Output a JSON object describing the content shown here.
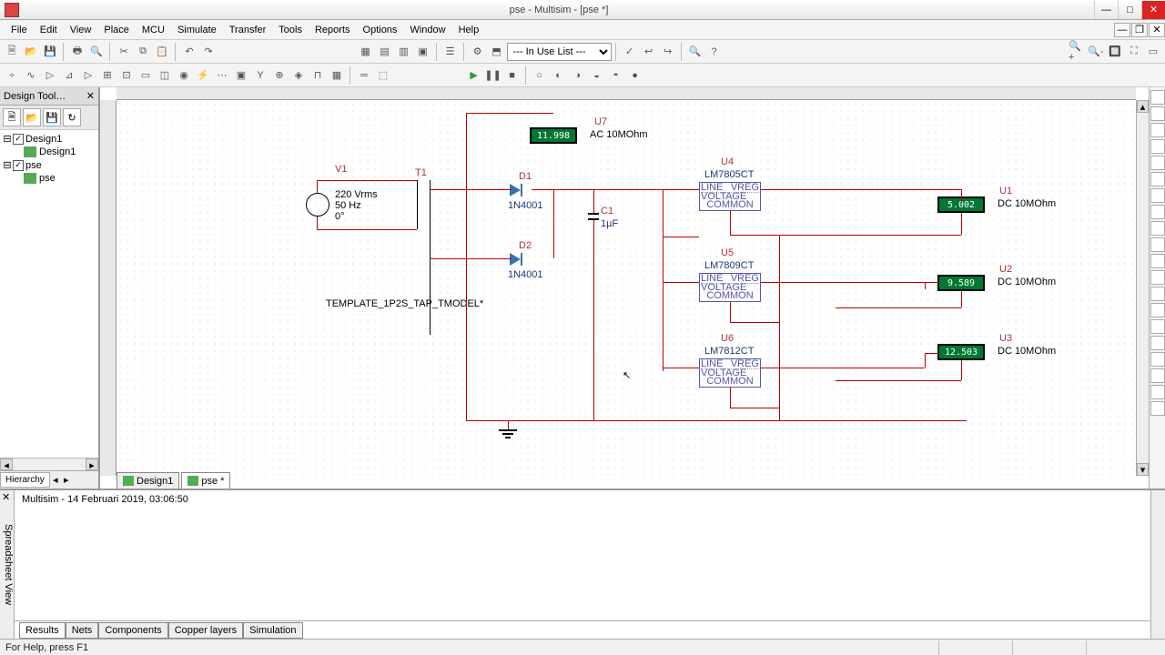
{
  "window": {
    "title": "pse - Multisim - [pse *]"
  },
  "menu": {
    "items": [
      "File",
      "Edit",
      "View",
      "Place",
      "MCU",
      "Simulate",
      "Transfer",
      "Tools",
      "Reports",
      "Options",
      "Window",
      "Help"
    ]
  },
  "toolbar1": {
    "component_filter": "--- In Use List ---"
  },
  "design_toolbox": {
    "title": "Design Tool…",
    "root1": "Design1",
    "child1": "Design1",
    "root2": "pse",
    "child2": "pse",
    "tab": "Hierarchy"
  },
  "schematic": {
    "V1": {
      "ref": "V1",
      "l1": "220 Vrms",
      "l2": "50 Hz",
      "l3": "0°"
    },
    "T1": {
      "ref": "T1",
      "model": "TEMPLATE_1P2S_TAP_TMODEL*"
    },
    "D1": {
      "ref": "D1",
      "val": "1N4001"
    },
    "D2": {
      "ref": "D2",
      "val": "1N4001"
    },
    "C1": {
      "ref": "C1",
      "val": "1µF"
    },
    "U4": {
      "ref": "U4",
      "val": "LM7805CT"
    },
    "U5": {
      "ref": "U5",
      "val": "LM7809CT"
    },
    "U6": {
      "ref": "U6",
      "val": "LM7812CT"
    },
    "reg_line": "LINE",
    "reg_vreg": "VREG",
    "reg_volt": "VOLTAGE",
    "reg_com": "COMMON",
    "U7": {
      "ref": "U7",
      "val": "AC  10MOhm",
      "reading": "11.998"
    },
    "U1": {
      "ref": "U1",
      "val": "DC  10MOhm",
      "reading": "5.002"
    },
    "U2": {
      "ref": "U2",
      "val": "DC  10MOhm",
      "reading": "9.589"
    },
    "U3": {
      "ref": "U3",
      "val": "DC  10MOhm",
      "reading": "12.503"
    },
    "tabs": [
      "Design1",
      "pse *"
    ]
  },
  "spreadsheet": {
    "label": "Spreadsheet View",
    "log": "Multisim  -  14 Februari 2019, 03:06:50",
    "tabs": [
      "Results",
      "Nets",
      "Components",
      "Copper layers",
      "Simulation"
    ]
  },
  "status": {
    "help": "For Help, press F1"
  }
}
